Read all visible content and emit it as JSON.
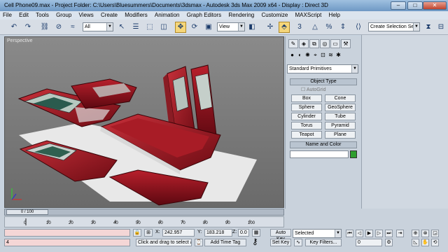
{
  "window": {
    "title": "Cell Phone09.max   - Project Folder: C:\\Users\\Bluesummers\\Documents\\3dsmax    - Autodesk 3ds Max  2009 x64    - Display : Direct 3D",
    "minimize": "–",
    "maximize": "□",
    "close": "✕"
  },
  "menu": [
    "File",
    "Edit",
    "Tools",
    "Group",
    "Views",
    "Create",
    "Modifiers",
    "Animation",
    "Graph Editors",
    "Rendering",
    "Customize",
    "MAXScript",
    "Help"
  ],
  "toolbar": {
    "selection_filter": "All",
    "reference_coord": "View",
    "named_selection_placeholder": "Create Selection Set"
  },
  "viewport": {
    "label": "Perspective"
  },
  "command_panel": {
    "category": "Standard Primitives",
    "object_type_header": "Object Type",
    "autogrid": "AutoGrid",
    "primitives": [
      "Box",
      "Cone",
      "Sphere",
      "GeoSphere",
      "Cylinder",
      "Tube",
      "Torus",
      "Pyramid",
      "Teapot",
      "Plane"
    ],
    "name_color_header": "Name and Color",
    "name_value": "",
    "color": "#2e9e2e"
  },
  "timeline": {
    "slider_label": "0 / 100",
    "ticks": [
      "0",
      "10",
      "20",
      "30",
      "40",
      "50",
      "60",
      "70",
      "80",
      "90",
      "100"
    ]
  },
  "status": {
    "frame_field": "4",
    "coord_x_label": "X:",
    "coord_x": "242.957",
    "coord_y_label": "Y:",
    "coord_y": "183.218",
    "coord_z_label": "Z:",
    "coord_z": "0.0",
    "prompt": "Click and drag to select ar",
    "add_time_tag": "Add Time Tag",
    "auto_key": "Auto Key",
    "set_key": "Set Key",
    "selected_option": "Selected",
    "key_filters": "Key Filters...",
    "current_frame": "0"
  }
}
